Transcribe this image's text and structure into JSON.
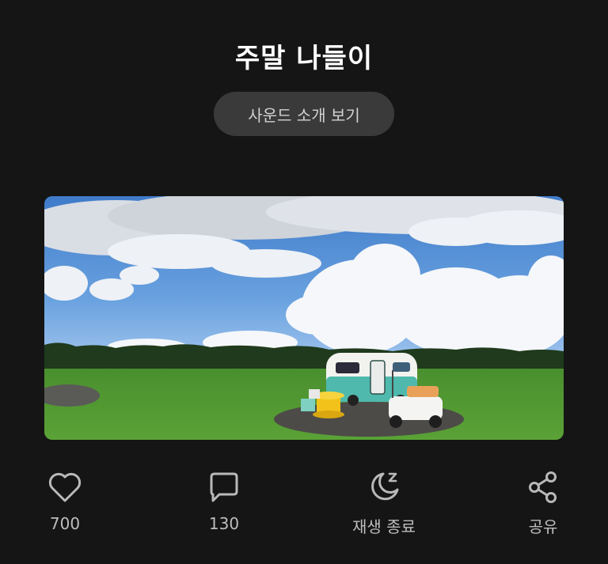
{
  "header": {
    "title": "주말 나들이",
    "sound_button_label": "사운드 소개 보기"
  },
  "photo": {
    "description_icon": "landscape-photo"
  },
  "actions": {
    "like": {
      "icon": "heart-icon",
      "count": "700"
    },
    "comment": {
      "icon": "comment-icon",
      "count": "130"
    },
    "sleep_timer": {
      "icon": "moon-sleep-icon",
      "label": "재생 종료"
    },
    "share": {
      "icon": "share-icon",
      "label": "공유"
    }
  },
  "colors": {
    "background": "#151515",
    "button_bg": "#3a3a3a",
    "icon_gray": "#b9b9b9"
  }
}
